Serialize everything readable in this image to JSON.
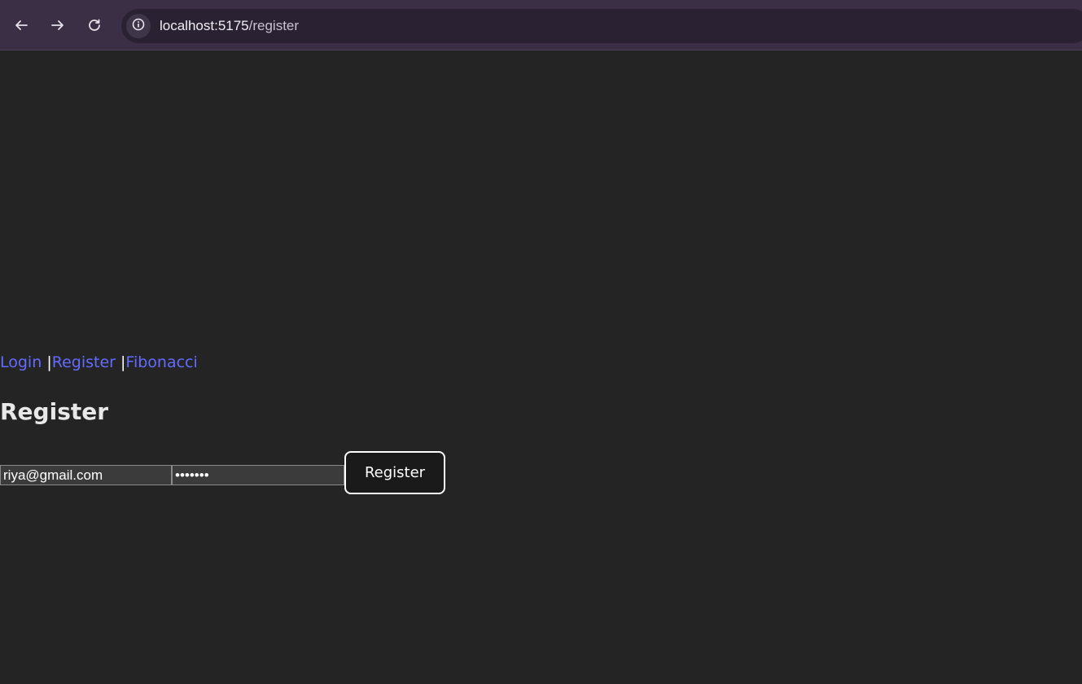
{
  "browser": {
    "url_host": "localhost:5175",
    "url_path": "/register",
    "icons": {
      "back": "arrow-left-icon",
      "forward": "arrow-right-icon",
      "reload": "reload-icon",
      "site_info": "info-icon"
    }
  },
  "nav": {
    "links": [
      {
        "label": "Login"
      },
      {
        "label": "Register"
      },
      {
        "label": "Fibonacci"
      }
    ],
    "separator": "|"
  },
  "page": {
    "title": "Register"
  },
  "form": {
    "email_value": "riya@gmail.com",
    "password_value": "1234567",
    "submit_label": "Register"
  },
  "colors": {
    "background": "#242424",
    "link": "#646cff",
    "browser_chrome": "#3a2f44"
  }
}
